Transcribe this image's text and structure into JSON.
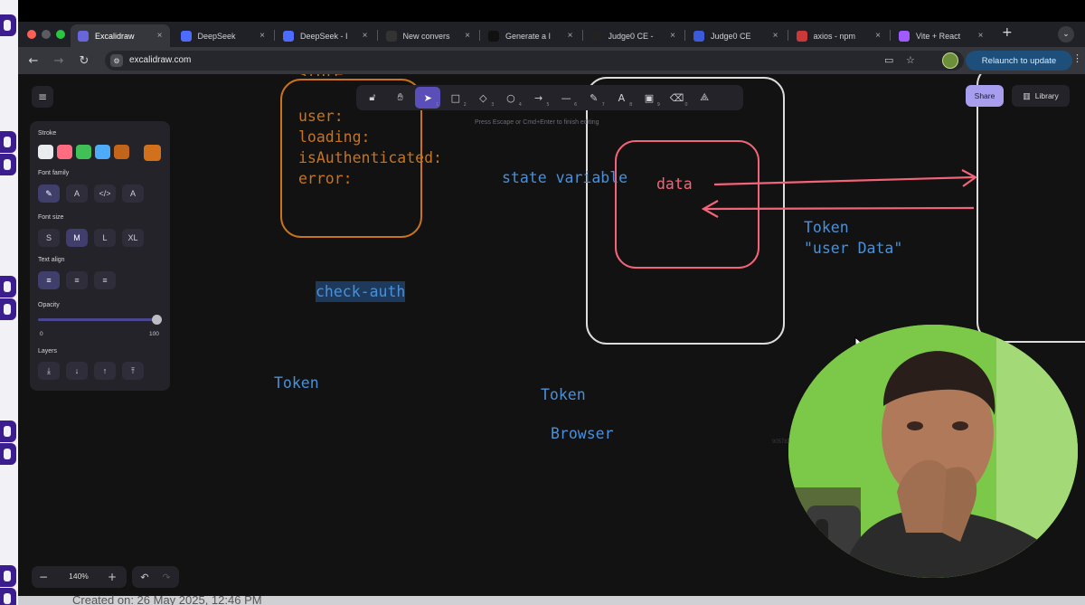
{
  "browser": {
    "tabs": [
      {
        "label": "Excalidraw",
        "icon": "excalidraw-icon",
        "color": "#6965db",
        "active": true
      },
      {
        "label": "DeepSeek",
        "icon": "deepseek-icon",
        "color": "#4d6bfe"
      },
      {
        "label": "DeepSeek - I",
        "icon": "deepseek-icon",
        "color": "#4d6bfe"
      },
      {
        "label": "New convers",
        "icon": "openai-icon",
        "color": "#333333"
      },
      {
        "label": "Generate a I",
        "icon": "dev-icon",
        "color": "#111111"
      },
      {
        "label": "Judge0 CE -",
        "icon": "judge0-icon",
        "color": "#222222"
      },
      {
        "label": "Judge0 CE",
        "icon": "judge0-icon",
        "color": "#3b5bdb"
      },
      {
        "label": "axios - npm",
        "icon": "npm-icon",
        "color": "#cb3837"
      },
      {
        "label": "Vite + React",
        "icon": "vite-icon",
        "color": "#9f5bff"
      }
    ],
    "tab_close": "×",
    "new_tab": "+",
    "tab_menu": "⌄",
    "url": "excalidraw.com",
    "relaunch_label": "Relaunch to update",
    "relaunch_more": "⋮"
  },
  "excalidraw": {
    "menu_icon": "≡",
    "tools": [
      {
        "name": "lock-tool",
        "glyph": "🔓︎",
        "key": ""
      },
      {
        "name": "hand-tool",
        "glyph": "✋︎",
        "key": ""
      },
      {
        "name": "selection-tool",
        "glyph": "➤",
        "key": "1",
        "active": true
      },
      {
        "name": "rectangle-tool",
        "glyph": "□",
        "key": "2"
      },
      {
        "name": "diamond-tool",
        "glyph": "◇",
        "key": "3"
      },
      {
        "name": "ellipse-tool",
        "glyph": "○",
        "key": "4"
      },
      {
        "name": "arrow-tool",
        "glyph": "→",
        "key": "5"
      },
      {
        "name": "line-tool",
        "glyph": "—",
        "key": "6"
      },
      {
        "name": "pencil-tool",
        "glyph": "✎",
        "key": "7"
      },
      {
        "name": "text-tool",
        "glyph": "A",
        "key": "8"
      },
      {
        "name": "image-tool",
        "glyph": "▣",
        "key": "9"
      },
      {
        "name": "eraser-tool",
        "glyph": "⌫",
        "key": "0"
      },
      {
        "name": "more-tools",
        "glyph": "⟁",
        "key": ""
      }
    ],
    "hint": "Press Escape or Cmd+Enter to finish editing",
    "share_label": "Share",
    "library_label": "Library",
    "props": {
      "stroke_label": "Stroke",
      "stroke_colors": [
        "#e9ecef",
        "#ff6b81",
        "#40c057",
        "#4dabf7",
        "#c2651a"
      ],
      "current_stroke": "#d3701c",
      "font_family_label": "Font family",
      "font_family_options": [
        "✎",
        "A",
        "</>",
        "A"
      ],
      "font_size_label": "Font size",
      "font_sizes": [
        "S",
        "M",
        "L",
        "XL"
      ],
      "selected_font_size": "M",
      "text_align_label": "Text align",
      "text_align_options": [
        "≡",
        "≡",
        "≡"
      ],
      "opacity_label": "Opacity",
      "opacity_min": "0",
      "opacity_max": "100",
      "opacity_value": 100,
      "layers_label": "Layers",
      "layer_buttons": [
        "⤓",
        "↓",
        "↑",
        "⤒"
      ]
    },
    "zoom": {
      "minus": "−",
      "value": "140%",
      "plus": "+"
    },
    "undo": "↶",
    "redo": "↷",
    "canvas_text": {
      "store_title": "store",
      "store_body": "user:\nloading:\nisAuthenticated:\nerror:",
      "check_auth": "check-auth",
      "state_variable": "state variable",
      "data": "data",
      "token_right": "Token\n\"user Data\"",
      "token_left": "Token",
      "token_center": "Token",
      "browser": "Browser",
      "tiny_label": "9057836"
    },
    "colors": {
      "orange": "#c9731c",
      "blue": "#4a90d9",
      "red": "#f36479",
      "white_box": "#dcdcdc"
    }
  },
  "footer": {
    "created": "Created on: 26 May 2025, 12:46 PM"
  }
}
